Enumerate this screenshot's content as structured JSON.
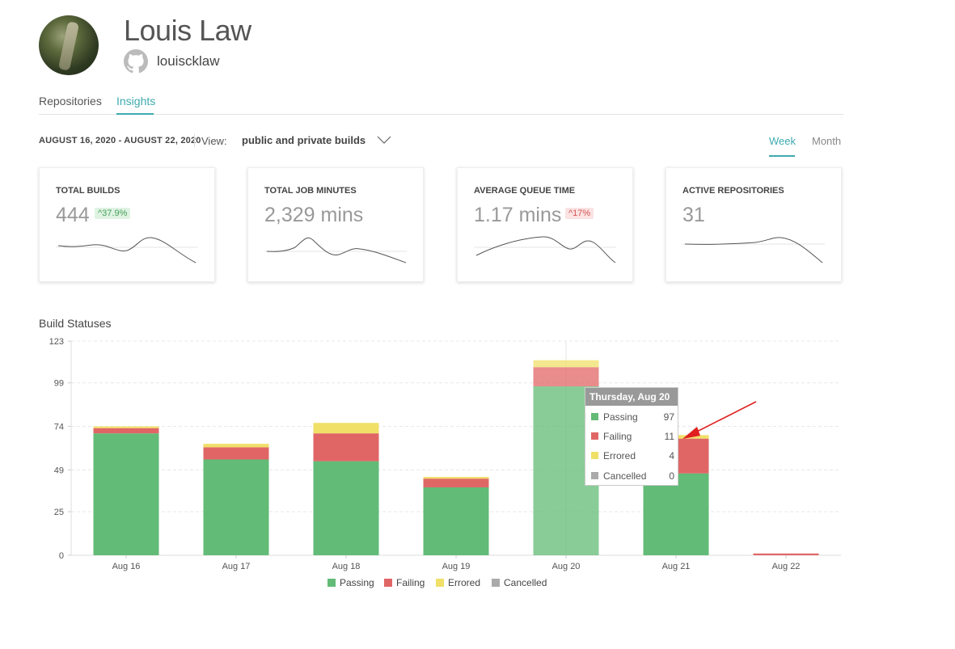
{
  "profile": {
    "name": "Louis Law",
    "handle": "louiscklaw"
  },
  "tabs": [
    {
      "label": "Repositories"
    },
    {
      "label": "Insights"
    }
  ],
  "filters": {
    "date_range": "AUGUST 16, 2020 - AUGUST 22, 2020",
    "view_label": "View:",
    "view_value": "public and private builds",
    "periods": [
      {
        "label": "Week"
      },
      {
        "label": "Month"
      }
    ]
  },
  "cards": [
    {
      "title": "TOTAL BUILDS",
      "value": "444",
      "badge": "37.9%",
      "badge_trend": "up",
      "badge_color": "#48a05b"
    },
    {
      "title": "TOTAL JOB MINUTES",
      "value": "2,329 mins"
    },
    {
      "title": "AVERAGE QUEUE TIME",
      "value": "1.17 mins",
      "badge": "17%",
      "badge_trend": "up",
      "badge_color": "#d25555"
    },
    {
      "title": "ACTIVE REPOSITORIES",
      "value": "31"
    }
  ],
  "build_statuses": {
    "title": "Build Statuses",
    "tooltip": {
      "title": "Thursday, Aug 20",
      "rows": [
        {
          "label": "Passing",
          "value": "97"
        },
        {
          "label": "Failing",
          "value": "11"
        },
        {
          "label": "Errored",
          "value": "4"
        },
        {
          "label": "Cancelled",
          "value": "0"
        }
      ]
    }
  },
  "colors": {
    "passing": "#62bb76",
    "failing": "#e06666",
    "errored": "#f0e068",
    "cancelled": "#aaaaaa",
    "accent": "#3eaaaf"
  },
  "chart_data": {
    "type": "bar",
    "stacked": true,
    "categories": [
      "Aug 16",
      "Aug 17",
      "Aug 18",
      "Aug 19",
      "Aug 20",
      "Aug 21",
      "Aug 22"
    ],
    "series": [
      {
        "name": "Passing",
        "values": [
          70,
          55,
          54,
          39,
          97,
          47,
          0
        ]
      },
      {
        "name": "Failing",
        "values": [
          3,
          7,
          16,
          5,
          11,
          20,
          1
        ]
      },
      {
        "name": "Errored",
        "values": [
          1,
          2,
          6,
          1,
          4,
          2,
          0
        ]
      },
      {
        "name": "Cancelled",
        "values": [
          0,
          0,
          0,
          0,
          0,
          0,
          0
        ]
      }
    ],
    "yticks": [
      0,
      25,
      49,
      74,
      99,
      123
    ],
    "ylim": [
      0,
      123
    ],
    "grid": true,
    "legend": "bottom"
  }
}
